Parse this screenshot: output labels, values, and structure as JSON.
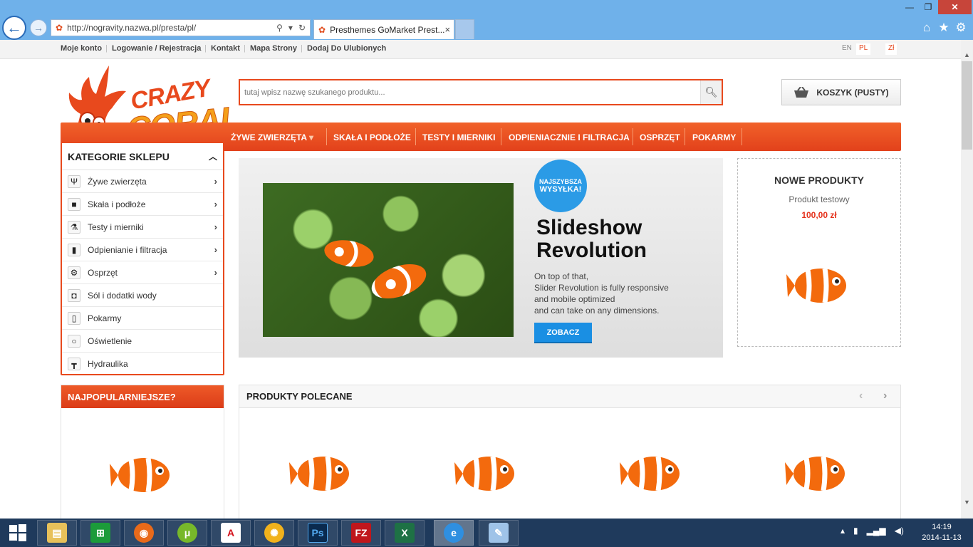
{
  "browser": {
    "url": "http://nogravity.nazwa.pl/presta/pl/",
    "tab_title": "Presthemes GoMarket Prest...",
    "back_glyph": "←",
    "fwd_glyph": "→",
    "close_glyph": "✕",
    "min_glyph": "—",
    "max_glyph": "❐",
    "tab_close": "×"
  },
  "topbar": {
    "links": [
      "Moje konto",
      "Logowanie / Rejestracja",
      "Kontakt",
      "Mapa Strony",
      "Dodaj Do Ulubionych"
    ],
    "sep": "|",
    "lang_en": "EN",
    "lang_pl": "PL",
    "currency": "Zł"
  },
  "logo": {
    "line1": "CRAZY",
    "line2": "CORAL"
  },
  "search": {
    "placeholder": "tutaj wpisz nazwę szukanego produktu..."
  },
  "cart": {
    "label": "KOSZYK (PUSTY)"
  },
  "nav": {
    "items": [
      "ŻYWE ZWIERZĘTA",
      "SKAŁA I PODŁOŻE",
      "TESTY I MIERNIKI",
      "ODPIENIACZNIE I FILTRACJA",
      "OSPRZĘT",
      "POKARMY"
    ]
  },
  "categories": {
    "title": "KATEGORIE SKLEPU",
    "items": [
      {
        "label": "Żywe zwierzęta",
        "icon": "coral-icon",
        "has_sub": true
      },
      {
        "label": "Skała i podłoże",
        "icon": "rock-icon",
        "has_sub": true
      },
      {
        "label": "Testy i mierniki",
        "icon": "flask-icon",
        "has_sub": true
      },
      {
        "label": "Odpienianie i filtracja",
        "icon": "skimmer-icon",
        "has_sub": true
      },
      {
        "label": "Osprzęt",
        "icon": "pump-icon",
        "has_sub": true
      },
      {
        "label": "Sól i dodatki wody",
        "icon": "bucket-icon",
        "has_sub": false
      },
      {
        "label": "Pokarmy",
        "icon": "food-can-icon",
        "has_sub": false
      },
      {
        "label": "Oświetlenie",
        "icon": "bulb-icon",
        "has_sub": false
      },
      {
        "label": "Hydraulika",
        "icon": "pipe-icon",
        "has_sub": false
      }
    ]
  },
  "slider": {
    "badge_line1": "NAJSZYBSZA",
    "badge_line2": "WYSYŁKA!",
    "title_line1": "Slideshow",
    "title_line2": "Revolution",
    "text": [
      "On top of that,",
      "Slider Revolution is fully responsive",
      "and mobile optimized",
      "and can take on any dimensions."
    ],
    "button": "ZOBACZ"
  },
  "new_products": {
    "title": "NOWE PRODUKTY",
    "product_name": "Produkt testowy",
    "price": "100,00 zł"
  },
  "popular": {
    "title": "NAJPOPULARNIEJSZE?"
  },
  "featured": {
    "title": "PRODUKTY POLECANE",
    "prev": "‹",
    "next": "›"
  },
  "taskbar": {
    "apps": [
      "file-explorer",
      "store",
      "firefox",
      "utorrent",
      "acrobat",
      "picasa",
      "photoshop",
      "filezilla",
      "excel",
      "internet-explorer",
      "notes"
    ],
    "time": "14:19",
    "date": "2014-11-13"
  },
  "colors": {
    "accent": "#e8491d",
    "nav": "#e94a1f",
    "price": "#e5311b",
    "slider_button": "#1a8fe3",
    "badge": "#2b9be6"
  }
}
